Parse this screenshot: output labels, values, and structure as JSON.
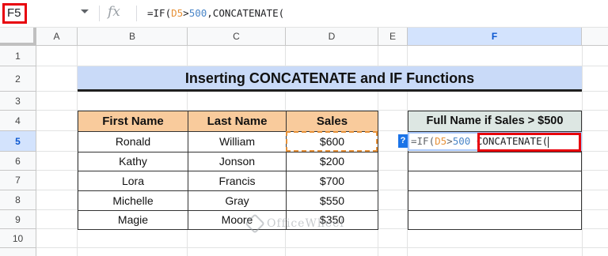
{
  "formula_bar": {
    "cell_ref": "F5",
    "fx_label": "fx",
    "formula_prefix": "=IF(",
    "formula_ref": "D5",
    "formula_op": ">",
    "formula_num": "500",
    "formula_rest": ",CONCATENATE("
  },
  "columns": [
    "A",
    "B",
    "C",
    "D",
    "E",
    "F"
  ],
  "rows": [
    "1",
    "2",
    "3",
    "4",
    "5",
    "6",
    "7",
    "8",
    "9",
    "10"
  ],
  "title": "Inserting CONCATENATE and IF Functions",
  "table": {
    "headers": [
      "First Name",
      "Last Name",
      "Sales"
    ],
    "rows": [
      [
        "Ronald",
        "William",
        "$600"
      ],
      [
        "Kathy",
        "Jonson",
        "$200"
      ],
      [
        "Lora",
        "Francis",
        "$700"
      ],
      [
        "Michelle",
        "Gray",
        "$550"
      ],
      [
        "Magie",
        "Moore",
        "$350"
      ]
    ]
  },
  "result_header": "Full Name if Sales > $500",
  "editor": {
    "help": "?",
    "prefix": "=IF(",
    "ref": "D5",
    "op": ">",
    "num": "500",
    "fn": "CONCATENATE("
  },
  "watermark": "OfficeWheel",
  "colors": {
    "selected_header": "#d3e3fd",
    "title_bg": "#c9daf8",
    "table_header_bg": "#f9cb9c",
    "result_header_bg": "#dde7e3",
    "highlight": "#e8000b",
    "reference": "#e69138"
  }
}
